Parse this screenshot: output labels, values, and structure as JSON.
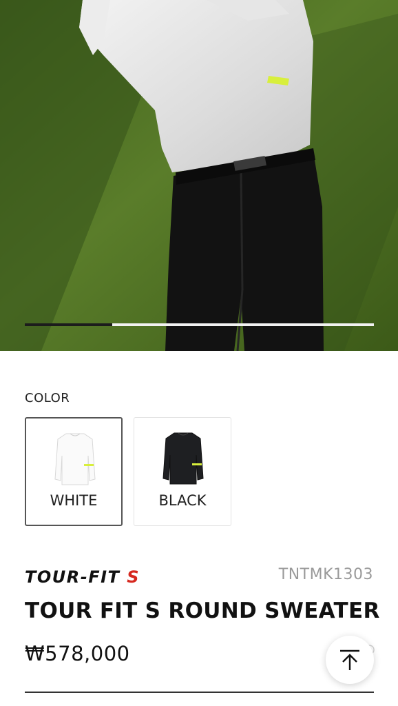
{
  "hero": {
    "image_alt": "Golfer in white sweater and black pants swinging",
    "carousel_progress": 0.25
  },
  "colors": {
    "section_label": "COLOR",
    "options": [
      {
        "label": "WHITE",
        "selected": true
      },
      {
        "label": "BLACK",
        "selected": false
      }
    ]
  },
  "product": {
    "brand": "TOUR-FIT S",
    "sku": "TNTMK1303",
    "title": "TOUR FIT S ROUND SWEATER",
    "price": "₩578,000"
  },
  "theme": {
    "accent_red": "#d6281f",
    "accent_yellow": "#d8ef3c",
    "turf_green": "#4f7224"
  },
  "icons": {
    "back_to_top": "arrow-up-to-line-icon",
    "wishlist": "heart-outline-icon"
  }
}
